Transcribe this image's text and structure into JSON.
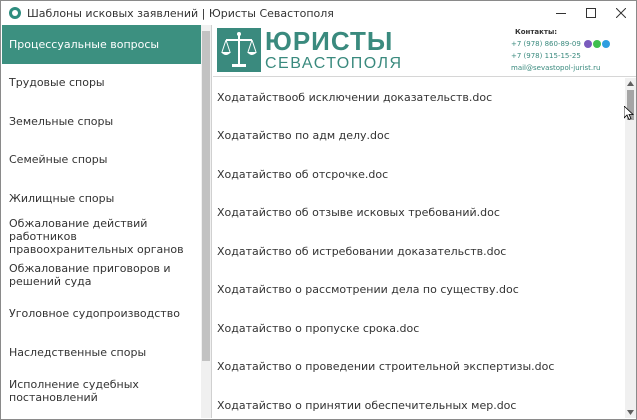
{
  "window": {
    "title": "Шаблоны исковых заявлений | Юристы Севастополя"
  },
  "sidebar": {
    "items": [
      {
        "label": "Процессуальные вопросы",
        "active": true
      },
      {
        "label": "Трудовые споры"
      },
      {
        "label": "Земельные споры"
      },
      {
        "label": "Семейные споры"
      },
      {
        "label": "Жилищные споры"
      },
      {
        "label": "Обжалование действий работников правоохранительных органов"
      },
      {
        "label": "Обжалование приговоров и решений суда"
      },
      {
        "label": "Уголовное судопроизводство"
      },
      {
        "label": "Наследственные споры"
      },
      {
        "label": "Исполнение судебных постановлений"
      }
    ]
  },
  "header": {
    "logo_top": "ЮРИСТЫ",
    "logo_bottom": "СЕВАСТОПОЛЯ",
    "contacts_title": "Контакты:",
    "phone1": "+7 (978) 860-89-09",
    "phone2": "+7 (978) 115-15-25",
    "email": "mail@sevastopol-jurist.ru",
    "brand_color": "#3a8a7e",
    "accent_color": "#3c9080"
  },
  "files": {
    "items": [
      "Ходатайствооб исключении доказательств.doc",
      "Ходатайство по адм делу.doc",
      "Ходатайство об отсрочке.doc",
      "Ходатайство об отзыве исковых требований.doc",
      "Ходатайство об истребовании доказательств.doc",
      "Ходатайство о рассмотрении дела по существу.doc",
      "Ходатайство о пропуске срока.doc",
      "Ходатайство о проведении строительной экспертизы.doc",
      "Ходатайство о принятии обеспечительных мер.doc"
    ]
  }
}
